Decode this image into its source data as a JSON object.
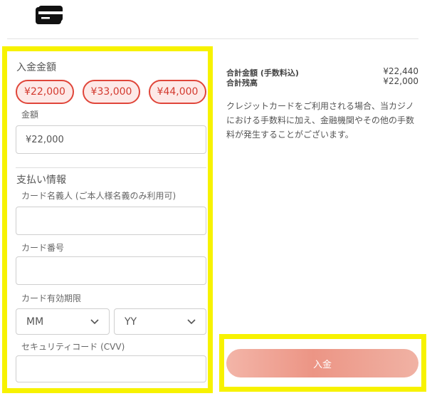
{
  "icons": {
    "card": "credit-card-icon",
    "chevron": "chevron-down-icon"
  },
  "deposit_amount": {
    "title": "入金金額",
    "presets": [
      "¥22,000",
      "¥33,000",
      "¥44,000"
    ],
    "amount_label": "金額",
    "amount_value": "¥22,000"
  },
  "payment_info": {
    "title": "支払い情報",
    "cardholder_label": "カード名義人 (ご本人様名義のみ利用可)",
    "card_number_label": "カード番号",
    "expiry_label": "カード有効期限",
    "month_selected": "MM",
    "year_selected": "YY",
    "cvv_label": "セキュリティコード (CVV)"
  },
  "summary": {
    "total_label": "合計金額 (手数料込)",
    "total_value": "¥22,440",
    "balance_label": "合計残高",
    "balance_value": "¥22,000",
    "note": "クレジットカードをご利用される場合、当カジノにおける手数料に加え、金融機関やその他の手数料が発生することがございます。"
  },
  "actions": {
    "deposit_label": "入金"
  },
  "colors": {
    "highlight": "#f7f200",
    "accent_red": "#e0463a",
    "pill_bg": "#fde9e7",
    "button": "#ec9585"
  }
}
